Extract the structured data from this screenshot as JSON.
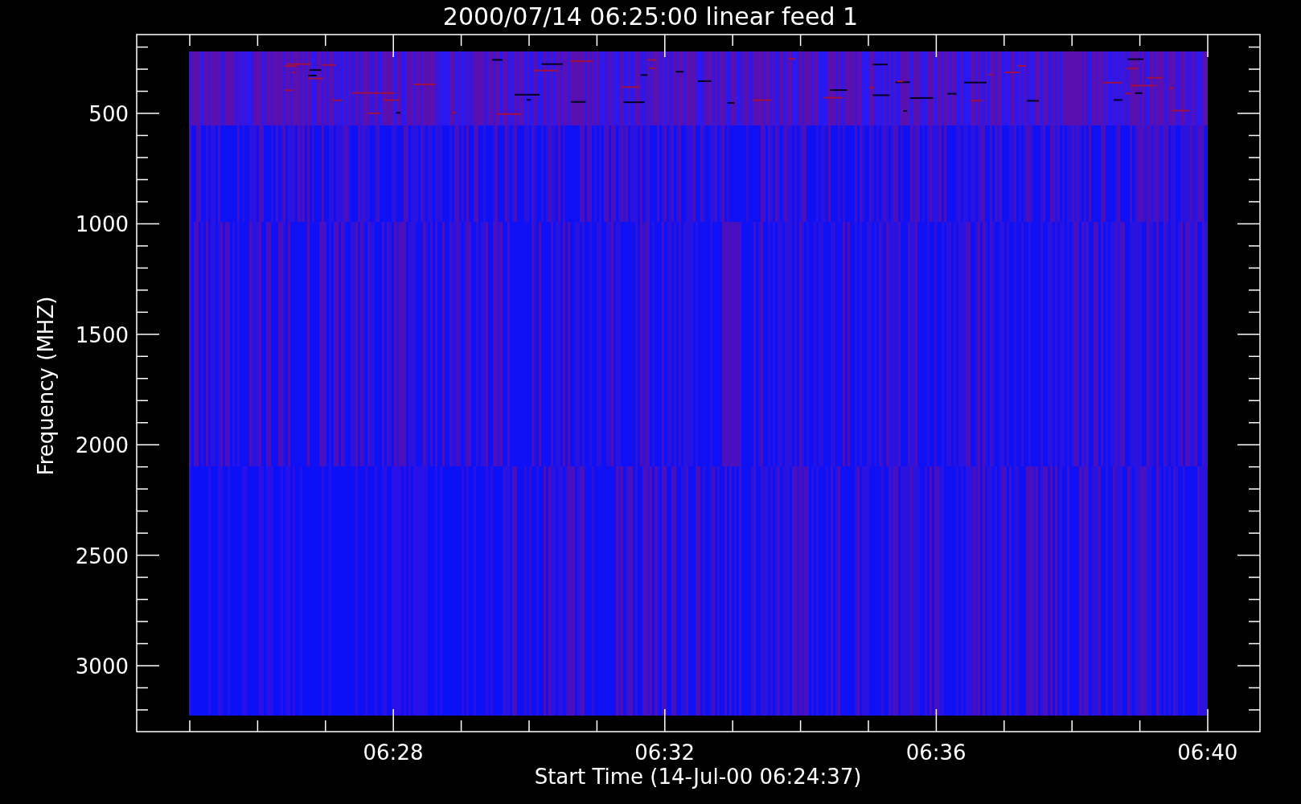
{
  "title": "2000/07/14 06:25:00 linear feed 1",
  "y_axis": {
    "label": "Frequency (MHZ)",
    "ticks": [
      "500",
      "1000",
      "1500",
      "2000",
      "2500",
      "3000"
    ]
  },
  "x_axis": {
    "label": "Start Time (14-Jul-00 06:24:37)",
    "ticks": [
      "06:28",
      "06:32",
      "06:36",
      "06:40"
    ]
  }
}
